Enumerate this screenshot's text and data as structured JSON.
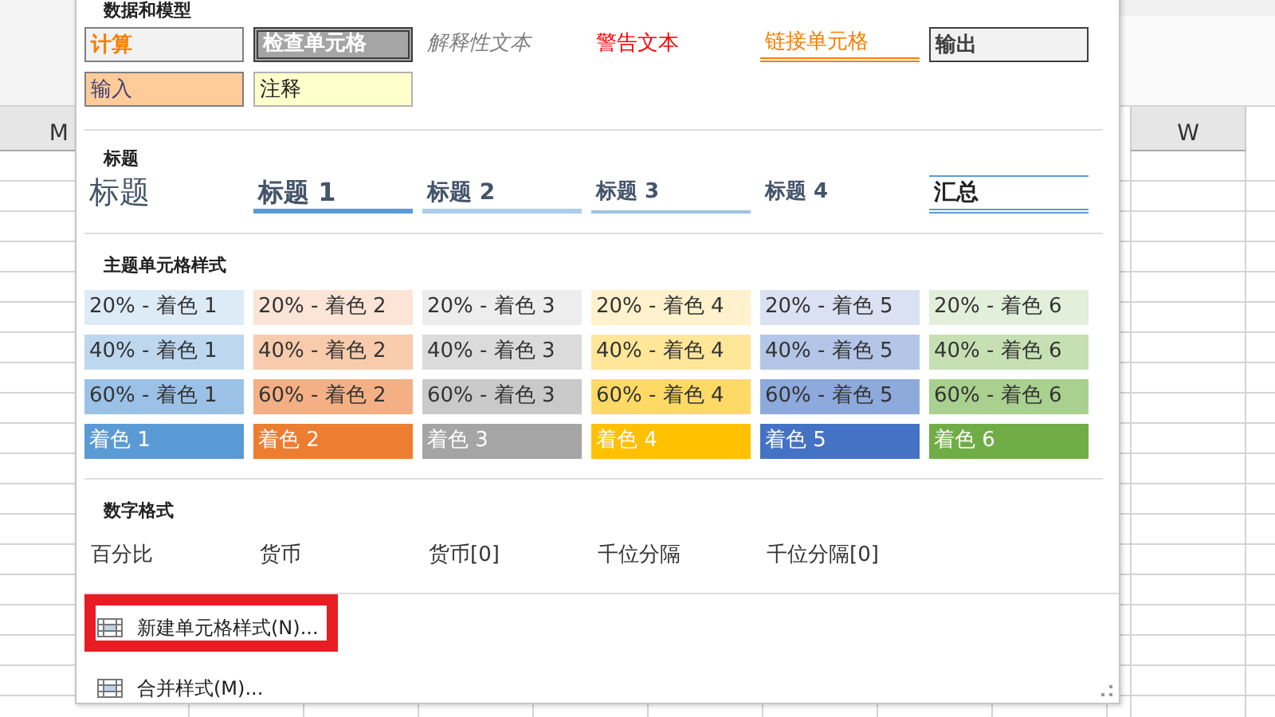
{
  "sheet": {
    "left_column": "M",
    "right_column": "W"
  },
  "sections": [
    {
      "kind": "model",
      "title": "数据和模型",
      "items": [
        {
          "text": "计算",
          "kind": "calc"
        },
        {
          "text": "检查单元格",
          "kind": "check"
        },
        {
          "text": "解释性文本",
          "kind": "explanatory"
        },
        {
          "text": "警告文本",
          "kind": "warning"
        },
        {
          "text": "链接单元格",
          "kind": "linked"
        },
        {
          "text": "输出",
          "kind": "output"
        },
        {
          "text": "输入",
          "kind": "input"
        },
        {
          "text": "注释",
          "kind": "note"
        }
      ]
    },
    {
      "kind": "headings",
      "title": "标题",
      "items": [
        {
          "text": "标题",
          "kind": "title"
        },
        {
          "text": "标题 1",
          "kind": "h1"
        },
        {
          "text": "标题 2",
          "kind": "h2"
        },
        {
          "text": "标题 3",
          "kind": "h3"
        },
        {
          "text": "标题 4",
          "kind": "h4"
        },
        {
          "text": "汇总",
          "kind": "total"
        }
      ]
    },
    {
      "kind": "theme",
      "title": "主题单元格样式",
      "items": [
        {
          "text": "20% - 着色 1",
          "color": "#ddebf7",
          "kind": "light"
        },
        {
          "text": "20% - 着色 2",
          "color": "#fce4d6",
          "kind": "light"
        },
        {
          "text": "20% - 着色 3",
          "color": "#ededed",
          "kind": "light"
        },
        {
          "text": "20% - 着色 4",
          "color": "#fff2cc",
          "kind": "light"
        },
        {
          "text": "20% - 着色 5",
          "color": "#d9e1f2",
          "kind": "light"
        },
        {
          "text": "20% - 着色 6",
          "color": "#e2efda",
          "kind": "light"
        },
        {
          "text": "40% - 着色 1",
          "color": "#bdd7ee",
          "kind": "light"
        },
        {
          "text": "40% - 着色 2",
          "color": "#f8cbad",
          "kind": "light"
        },
        {
          "text": "40% - 着色 3",
          "color": "#dbdbdb",
          "kind": "light"
        },
        {
          "text": "40% - 着色 4",
          "color": "#ffe699",
          "kind": "light"
        },
        {
          "text": "40% - 着色 5",
          "color": "#b4c6e7",
          "kind": "light"
        },
        {
          "text": "40% - 着色 6",
          "color": "#c6e0b4",
          "kind": "light"
        },
        {
          "text": "60% - 着色 1",
          "color": "#9bc2e6",
          "kind": "light"
        },
        {
          "text": "60% - 着色 2",
          "color": "#f4b084",
          "kind": "light"
        },
        {
          "text": "60% - 着色 3",
          "color": "#c9c9c9",
          "kind": "light"
        },
        {
          "text": "60% - 着色 4",
          "color": "#ffd966",
          "kind": "light"
        },
        {
          "text": "60% - 着色 5",
          "color": "#8ea9db",
          "kind": "light"
        },
        {
          "text": "60% - 着色 6",
          "color": "#a9d08e",
          "kind": "light"
        },
        {
          "text": "着色 1",
          "color": "#5b9bd5",
          "kind": "dark"
        },
        {
          "text": "着色 2",
          "color": "#ed7d31",
          "kind": "dark"
        },
        {
          "text": "着色 3",
          "color": "#a5a5a5",
          "kind": "dark"
        },
        {
          "text": "着色 4",
          "color": "#ffc000",
          "kind": "dark"
        },
        {
          "text": "着色 5",
          "color": "#4472c4",
          "kind": "dark"
        },
        {
          "text": "着色 6",
          "color": "#70ad47",
          "kind": "dark"
        }
      ]
    },
    {
      "kind": "number",
      "title": "数字格式",
      "items": [
        {
          "text": "百分比",
          "kind": "plain"
        },
        {
          "text": "货币",
          "kind": "plain"
        },
        {
          "text": "货币[0]",
          "kind": "plain"
        },
        {
          "text": "千位分隔",
          "kind": "plain"
        },
        {
          "text": "千位分隔[0]",
          "kind": "plain"
        }
      ]
    }
  ],
  "menu": [
    {
      "label": "新建单元格样式(N)...",
      "highlighted": true
    },
    {
      "label": "合并样式(M)...",
      "highlighted": false
    }
  ]
}
